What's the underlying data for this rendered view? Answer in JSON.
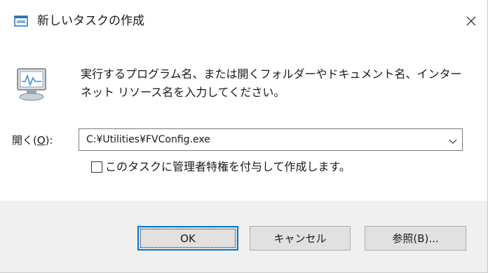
{
  "window": {
    "title": "新しいタスクの作成"
  },
  "icons": {
    "title_icon": "run-dialog-icon",
    "close_icon": "close-icon",
    "program_icon": "run-program-monitor-icon",
    "dropdown_icon": "chevron-down-icon"
  },
  "description": {
    "line1": "実行するプログラム名、または開くフォルダーやドキュメント名、インター",
    "line2": "ネット リソース名を入力してください。"
  },
  "open_field": {
    "label_prefix": "開く(",
    "label_accel": "O",
    "label_suffix": "):",
    "value": "C:¥Utilities¥FVConfig.exe"
  },
  "admin_option": {
    "label": "このタスクに管理者特権を付与して作成します。",
    "checked": false
  },
  "buttons": {
    "ok": "OK",
    "cancel": "キャンセル",
    "browse": "参照(B)..."
  },
  "colors": {
    "accent_focus": "#0078d7",
    "footer_bg": "#f0f0f0",
    "button_bg": "#e1e1e1",
    "icon_blue": "#2b6fb6"
  }
}
